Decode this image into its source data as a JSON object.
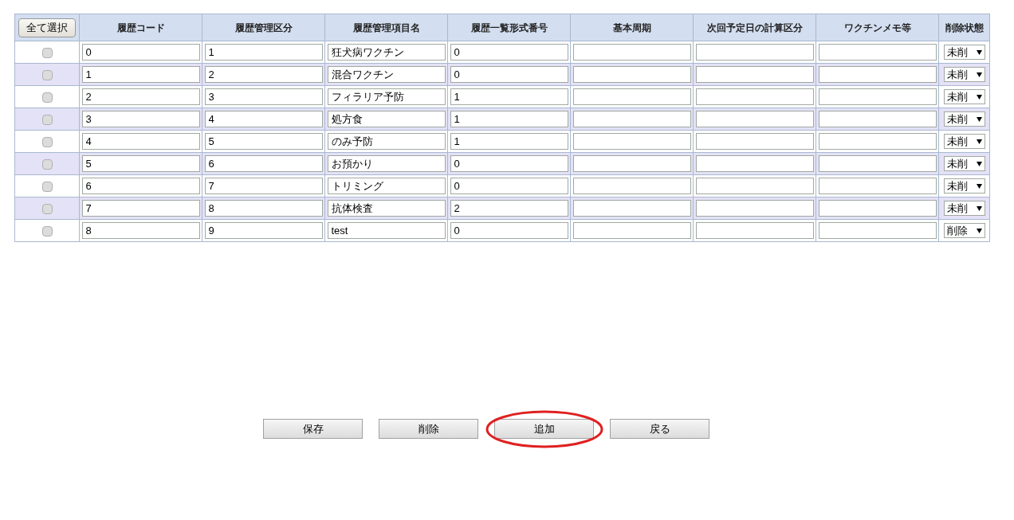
{
  "select_all_button": "全て選択",
  "columns": [
    "履歴コード",
    "履歴管理区分",
    "履歴管理項目名",
    "履歴一覧形式番号",
    "基本周期",
    "次回予定日の計算区分",
    "ワクチンメモ等",
    "削除状態"
  ],
  "rows": [
    {
      "checked": false,
      "code": "0",
      "category": "1",
      "name": "狂犬病ワクチン",
      "format": "0",
      "deletion": "未削"
    },
    {
      "checked": false,
      "code": "1",
      "category": "2",
      "name": "混合ワクチン",
      "format": "0",
      "deletion": "未削"
    },
    {
      "checked": false,
      "code": "2",
      "category": "3",
      "name": "フィラリア予防",
      "format": "1",
      "deletion": "未削"
    },
    {
      "checked": false,
      "code": "3",
      "category": "4",
      "name": "処方食",
      "format": "1",
      "deletion": "未削"
    },
    {
      "checked": false,
      "code": "4",
      "category": "5",
      "name": "のみ予防",
      "format": "1",
      "deletion": "未削"
    },
    {
      "checked": false,
      "code": "5",
      "category": "6",
      "name": "お預かり",
      "format": "0",
      "deletion": "未削"
    },
    {
      "checked": false,
      "code": "6",
      "category": "7",
      "name": "トリミング",
      "format": "0",
      "deletion": "未削"
    },
    {
      "checked": false,
      "code": "7",
      "category": "8",
      "name": "抗体検査",
      "format": "2",
      "deletion": "未削"
    },
    {
      "checked": false,
      "code": "8",
      "category": "9",
      "name": "test",
      "format": "0",
      "deletion": "削除"
    }
  ],
  "buttons": [
    {
      "label": "保存",
      "highlighted": false
    },
    {
      "label": "削除",
      "highlighted": false
    },
    {
      "label": "追加",
      "highlighted": true
    },
    {
      "label": "戻る",
      "highlighted": false
    }
  ]
}
